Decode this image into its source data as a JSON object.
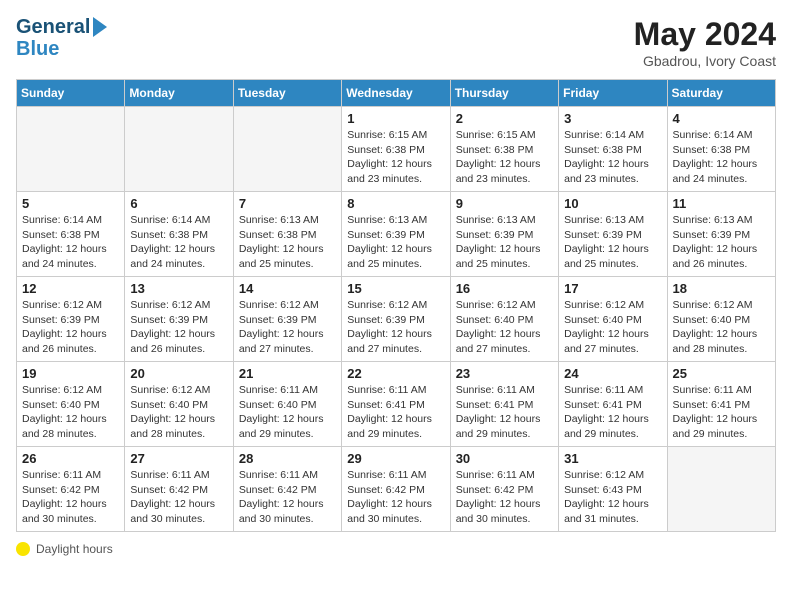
{
  "header": {
    "logo_line1": "General",
    "logo_line2": "Blue",
    "title": "May 2024",
    "subtitle": "Gbadrou, Ivory Coast"
  },
  "days_of_week": [
    "Sunday",
    "Monday",
    "Tuesday",
    "Wednesday",
    "Thursday",
    "Friday",
    "Saturday"
  ],
  "weeks": [
    [
      {
        "day": "",
        "info": ""
      },
      {
        "day": "",
        "info": ""
      },
      {
        "day": "",
        "info": ""
      },
      {
        "day": "1",
        "info": "Sunrise: 6:15 AM\nSunset: 6:38 PM\nDaylight: 12 hours\nand 23 minutes."
      },
      {
        "day": "2",
        "info": "Sunrise: 6:15 AM\nSunset: 6:38 PM\nDaylight: 12 hours\nand 23 minutes."
      },
      {
        "day": "3",
        "info": "Sunrise: 6:14 AM\nSunset: 6:38 PM\nDaylight: 12 hours\nand 23 minutes."
      },
      {
        "day": "4",
        "info": "Sunrise: 6:14 AM\nSunset: 6:38 PM\nDaylight: 12 hours\nand 24 minutes."
      }
    ],
    [
      {
        "day": "5",
        "info": "Sunrise: 6:14 AM\nSunset: 6:38 PM\nDaylight: 12 hours\nand 24 minutes."
      },
      {
        "day": "6",
        "info": "Sunrise: 6:14 AM\nSunset: 6:38 PM\nDaylight: 12 hours\nand 24 minutes."
      },
      {
        "day": "7",
        "info": "Sunrise: 6:13 AM\nSunset: 6:38 PM\nDaylight: 12 hours\nand 25 minutes."
      },
      {
        "day": "8",
        "info": "Sunrise: 6:13 AM\nSunset: 6:39 PM\nDaylight: 12 hours\nand 25 minutes."
      },
      {
        "day": "9",
        "info": "Sunrise: 6:13 AM\nSunset: 6:39 PM\nDaylight: 12 hours\nand 25 minutes."
      },
      {
        "day": "10",
        "info": "Sunrise: 6:13 AM\nSunset: 6:39 PM\nDaylight: 12 hours\nand 25 minutes."
      },
      {
        "day": "11",
        "info": "Sunrise: 6:13 AM\nSunset: 6:39 PM\nDaylight: 12 hours\nand 26 minutes."
      }
    ],
    [
      {
        "day": "12",
        "info": "Sunrise: 6:12 AM\nSunset: 6:39 PM\nDaylight: 12 hours\nand 26 minutes."
      },
      {
        "day": "13",
        "info": "Sunrise: 6:12 AM\nSunset: 6:39 PM\nDaylight: 12 hours\nand 26 minutes."
      },
      {
        "day": "14",
        "info": "Sunrise: 6:12 AM\nSunset: 6:39 PM\nDaylight: 12 hours\nand 27 minutes."
      },
      {
        "day": "15",
        "info": "Sunrise: 6:12 AM\nSunset: 6:39 PM\nDaylight: 12 hours\nand 27 minutes."
      },
      {
        "day": "16",
        "info": "Sunrise: 6:12 AM\nSunset: 6:40 PM\nDaylight: 12 hours\nand 27 minutes."
      },
      {
        "day": "17",
        "info": "Sunrise: 6:12 AM\nSunset: 6:40 PM\nDaylight: 12 hours\nand 27 minutes."
      },
      {
        "day": "18",
        "info": "Sunrise: 6:12 AM\nSunset: 6:40 PM\nDaylight: 12 hours\nand 28 minutes."
      }
    ],
    [
      {
        "day": "19",
        "info": "Sunrise: 6:12 AM\nSunset: 6:40 PM\nDaylight: 12 hours\nand 28 minutes."
      },
      {
        "day": "20",
        "info": "Sunrise: 6:12 AM\nSunset: 6:40 PM\nDaylight: 12 hours\nand 28 minutes."
      },
      {
        "day": "21",
        "info": "Sunrise: 6:11 AM\nSunset: 6:40 PM\nDaylight: 12 hours\nand 29 minutes."
      },
      {
        "day": "22",
        "info": "Sunrise: 6:11 AM\nSunset: 6:41 PM\nDaylight: 12 hours\nand 29 minutes."
      },
      {
        "day": "23",
        "info": "Sunrise: 6:11 AM\nSunset: 6:41 PM\nDaylight: 12 hours\nand 29 minutes."
      },
      {
        "day": "24",
        "info": "Sunrise: 6:11 AM\nSunset: 6:41 PM\nDaylight: 12 hours\nand 29 minutes."
      },
      {
        "day": "25",
        "info": "Sunrise: 6:11 AM\nSunset: 6:41 PM\nDaylight: 12 hours\nand 29 minutes."
      }
    ],
    [
      {
        "day": "26",
        "info": "Sunrise: 6:11 AM\nSunset: 6:42 PM\nDaylight: 12 hours\nand 30 minutes."
      },
      {
        "day": "27",
        "info": "Sunrise: 6:11 AM\nSunset: 6:42 PM\nDaylight: 12 hours\nand 30 minutes."
      },
      {
        "day": "28",
        "info": "Sunrise: 6:11 AM\nSunset: 6:42 PM\nDaylight: 12 hours\nand 30 minutes."
      },
      {
        "day": "29",
        "info": "Sunrise: 6:11 AM\nSunset: 6:42 PM\nDaylight: 12 hours\nand 30 minutes."
      },
      {
        "day": "30",
        "info": "Sunrise: 6:11 AM\nSunset: 6:42 PM\nDaylight: 12 hours\nand 30 minutes."
      },
      {
        "day": "31",
        "info": "Sunrise: 6:12 AM\nSunset: 6:43 PM\nDaylight: 12 hours\nand 31 minutes."
      },
      {
        "day": "",
        "info": ""
      }
    ]
  ],
  "legend": {
    "text": "Daylight hours"
  },
  "colors": {
    "header_bg": "#2e86c1",
    "accent": "#1a5276"
  }
}
